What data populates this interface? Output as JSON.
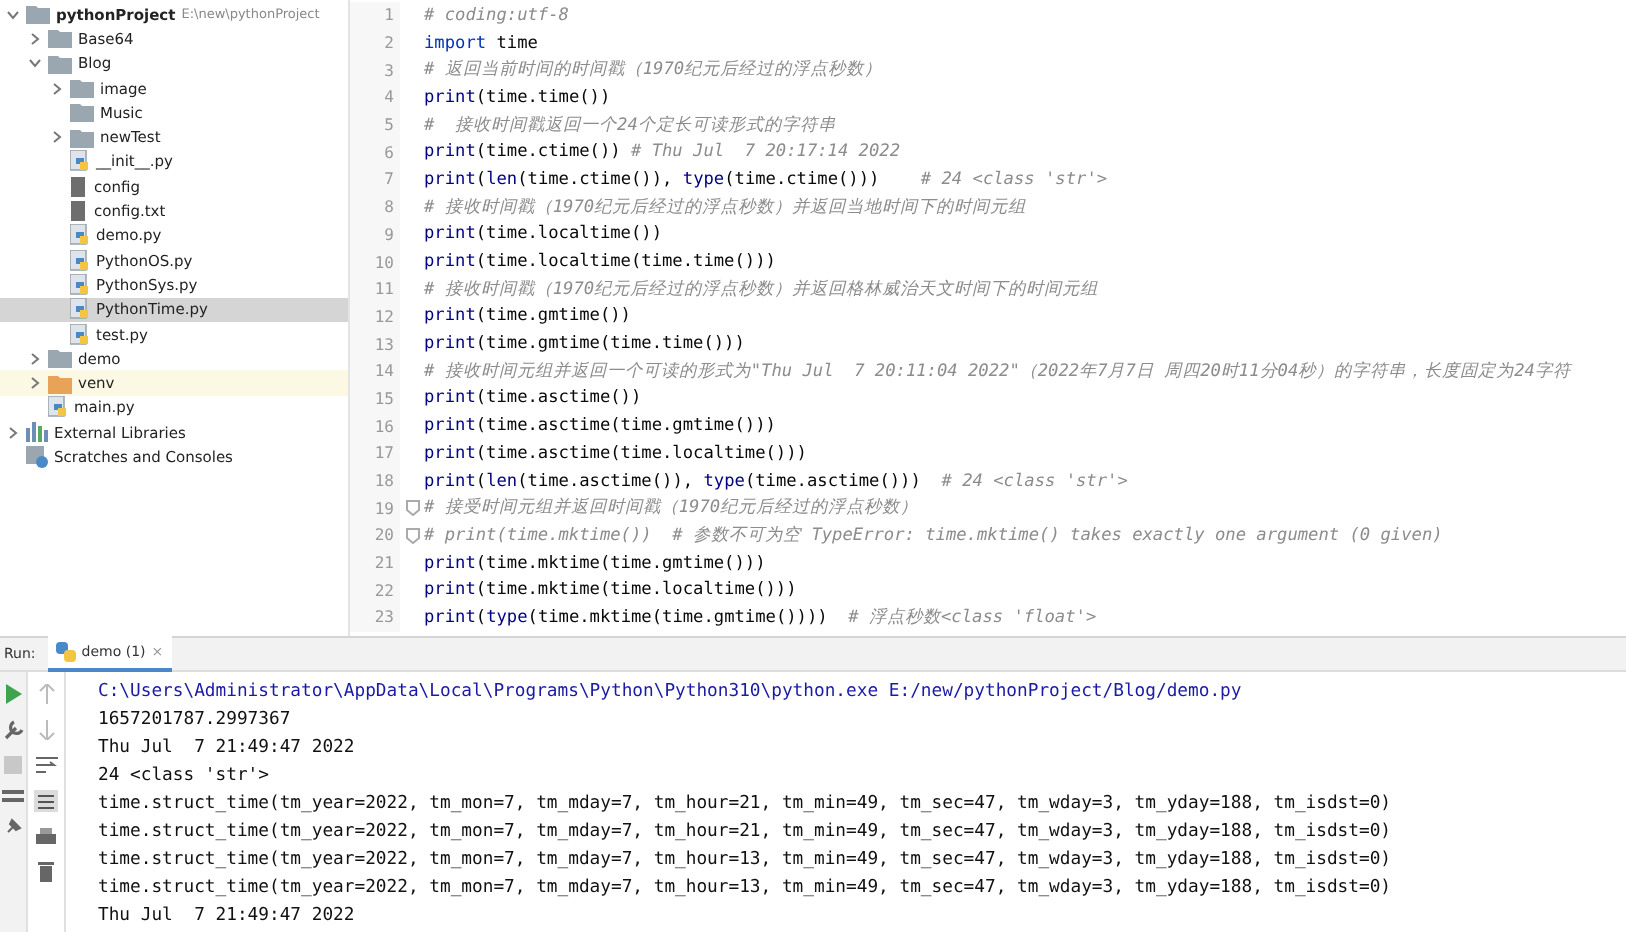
{
  "project_tree": {
    "items": [
      {
        "kind": "root",
        "label": "pythonProject",
        "path": "E:\\new\\pythonProject",
        "expanded": true,
        "selected": false,
        "children": [
          {
            "kind": "folder",
            "label": "Base64",
            "expanded": false,
            "selected": false
          },
          {
            "kind": "folder",
            "label": "Blog",
            "expanded": true,
            "selected": false,
            "children": [
              {
                "kind": "folder",
                "label": "image",
                "expanded": false,
                "selected": false
              },
              {
                "kind": "folder",
                "label": "Music",
                "selected": false
              },
              {
                "kind": "folder",
                "label": "newTest",
                "expanded": false,
                "selected": false
              },
              {
                "kind": "python",
                "label": "__init__.py",
                "selected": false
              },
              {
                "kind": "text",
                "label": "config",
                "selected": false
              },
              {
                "kind": "text",
                "label": "config.txt",
                "selected": false
              },
              {
                "kind": "python",
                "label": "demo.py",
                "selected": false
              },
              {
                "kind": "python",
                "label": "PythonOS.py",
                "selected": false
              },
              {
                "kind": "python",
                "label": "PythonSys.py",
                "selected": false
              },
              {
                "kind": "python",
                "label": "PythonTime.py",
                "selected": true
              },
              {
                "kind": "python",
                "label": "test.py",
                "selected": false
              }
            ]
          },
          {
            "kind": "folder",
            "label": "demo",
            "expanded": false,
            "selected": false
          },
          {
            "kind": "venv",
            "label": "venv",
            "expanded": false,
            "selected": false
          },
          {
            "kind": "python",
            "label": "main.py",
            "selected": false
          }
        ]
      },
      {
        "kind": "libraries",
        "label": "External Libraries",
        "expanded": false,
        "selected": false
      },
      {
        "kind": "scratches",
        "label": "Scratches and Consoles",
        "selected": false
      }
    ]
  },
  "editor": {
    "lines": [
      {
        "number": "1",
        "segments": [
          {
            "kind": "comment",
            "text": "# coding:utf-8"
          }
        ]
      },
      {
        "number": "2",
        "segments": [
          {
            "kind": "keyword",
            "text": "import"
          },
          {
            "kind": "code",
            "text": " time"
          }
        ]
      },
      {
        "number": "3",
        "segments": [
          {
            "kind": "comment",
            "text": "# 返回当前时间的时间戳（1970纪元后经过的浮点秒数）"
          }
        ]
      },
      {
        "number": "4",
        "segments": [
          {
            "kind": "builtin",
            "text": "print"
          },
          {
            "kind": "code",
            "text": "(time.time())"
          }
        ]
      },
      {
        "number": "5",
        "segments": [
          {
            "kind": "comment",
            "text": "#  接收时间戳返回一个24个定长可读形式的字符串"
          }
        ]
      },
      {
        "number": "6",
        "segments": [
          {
            "kind": "builtin",
            "text": "print"
          },
          {
            "kind": "code",
            "text": "(time.ctime()) "
          },
          {
            "kind": "comment",
            "text": "# Thu Jul  7 20:17:14 2022"
          }
        ]
      },
      {
        "number": "7",
        "segments": [
          {
            "kind": "builtin",
            "text": "print"
          },
          {
            "kind": "code",
            "text": "("
          },
          {
            "kind": "builtin",
            "text": "len"
          },
          {
            "kind": "code",
            "text": "(time.ctime()), "
          },
          {
            "kind": "builtin",
            "text": "type"
          },
          {
            "kind": "code",
            "text": "(time.ctime()))    "
          },
          {
            "kind": "comment",
            "text": "# 24 <class 'str'>"
          }
        ]
      },
      {
        "number": "8",
        "segments": [
          {
            "kind": "comment",
            "text": "# 接收时间戳（1970纪元后经过的浮点秒数）并返回当地时间下的时间元组"
          }
        ]
      },
      {
        "number": "9",
        "segments": [
          {
            "kind": "builtin",
            "text": "print"
          },
          {
            "kind": "code",
            "text": "(time.localtime())"
          }
        ]
      },
      {
        "number": "10",
        "segments": [
          {
            "kind": "builtin",
            "text": "print"
          },
          {
            "kind": "code",
            "text": "(time.localtime(time.time()))"
          }
        ]
      },
      {
        "number": "11",
        "segments": [
          {
            "kind": "comment",
            "text": "# 接收时间戳（1970纪元后经过的浮点秒数）并返回格林威治天文时间下的时间元组"
          }
        ]
      },
      {
        "number": "12",
        "segments": [
          {
            "kind": "builtin",
            "text": "print"
          },
          {
            "kind": "code",
            "text": "(time.gmtime())"
          }
        ]
      },
      {
        "number": "13",
        "segments": [
          {
            "kind": "builtin",
            "text": "print"
          },
          {
            "kind": "code",
            "text": "(time.gmtime(time.time()))"
          }
        ]
      },
      {
        "number": "14",
        "segments": [
          {
            "kind": "comment",
            "text": "# 接收时间元组并返回一个可读的形式为\"Thu Jul  7 20:11:04 2022\"（2022年7月7日 周四20时11分04秒）的字符串，长度固定为24字符"
          }
        ]
      },
      {
        "number": "15",
        "segments": [
          {
            "kind": "builtin",
            "text": "print"
          },
          {
            "kind": "code",
            "text": "(time.asctime())"
          }
        ]
      },
      {
        "number": "16",
        "segments": [
          {
            "kind": "builtin",
            "text": "print"
          },
          {
            "kind": "code",
            "text": "(time.asctime(time.gmtime()))"
          }
        ]
      },
      {
        "number": "17",
        "segments": [
          {
            "kind": "builtin",
            "text": "print"
          },
          {
            "kind": "code",
            "text": "(time.asctime(time.localtime()))"
          }
        ]
      },
      {
        "number": "18",
        "segments": [
          {
            "kind": "builtin",
            "text": "print"
          },
          {
            "kind": "code",
            "text": "("
          },
          {
            "kind": "builtin",
            "text": "len"
          },
          {
            "kind": "code",
            "text": "(time.asctime()), "
          },
          {
            "kind": "builtin",
            "text": "type"
          },
          {
            "kind": "code",
            "text": "(time.asctime()))  "
          },
          {
            "kind": "comment",
            "text": "# 24 <class 'str'>"
          }
        ]
      },
      {
        "number": "19",
        "fold": true,
        "segments": [
          {
            "kind": "comment",
            "text": "# 接受时间元组并返回时间戳（1970纪元后经过的浮点秒数）"
          }
        ]
      },
      {
        "number": "20",
        "fold": true,
        "segments": [
          {
            "kind": "comment",
            "text": "# print(time.mktime())  # 参数不可为空 TypeError: time.mktime() takes exactly one argument (0 given)"
          }
        ]
      },
      {
        "number": "21",
        "segments": [
          {
            "kind": "builtin",
            "text": "print"
          },
          {
            "kind": "code",
            "text": "(time.mktime(time.gmtime()))"
          }
        ]
      },
      {
        "number": "22",
        "segments": [
          {
            "kind": "builtin",
            "text": "print"
          },
          {
            "kind": "code",
            "text": "(time.mktime(time.localtime()))"
          }
        ]
      },
      {
        "number": "23",
        "segments": [
          {
            "kind": "builtin",
            "text": "print"
          },
          {
            "kind": "code",
            "text": "("
          },
          {
            "kind": "builtin",
            "text": "type"
          },
          {
            "kind": "code",
            "text": "(time.mktime(time.gmtime())))  "
          },
          {
            "kind": "comment",
            "text": "# 浮点秒数<class 'float'>"
          }
        ]
      }
    ]
  },
  "run_panel": {
    "label": "Run:",
    "tabs": [
      {
        "label": "demo (1)",
        "close": "×",
        "selected": true
      }
    ],
    "console": [
      {
        "kind": "command",
        "text": "C:\\Users\\Administrator\\AppData\\Local\\Programs\\Python\\Python310\\python.exe E:/new/pythonProject/Blog/demo.py"
      },
      {
        "kind": "output",
        "text": "1657201787.2997367"
      },
      {
        "kind": "output",
        "text": "Thu Jul  7 21:49:47 2022"
      },
      {
        "kind": "output",
        "text": "24 <class 'str'>"
      },
      {
        "kind": "output",
        "text": "time.struct_time(tm_year=2022, tm_mon=7, tm_mday=7, tm_hour=21, tm_min=49, tm_sec=47, tm_wday=3, tm_yday=188, tm_isdst=0)"
      },
      {
        "kind": "output",
        "text": "time.struct_time(tm_year=2022, tm_mon=7, tm_mday=7, tm_hour=21, tm_min=49, tm_sec=47, tm_wday=3, tm_yday=188, tm_isdst=0)"
      },
      {
        "kind": "output",
        "text": "time.struct_time(tm_year=2022, tm_mon=7, tm_mday=7, tm_hour=13, tm_min=49, tm_sec=47, tm_wday=3, tm_yday=188, tm_isdst=0)"
      },
      {
        "kind": "output",
        "text": "time.struct_time(tm_year=2022, tm_mon=7, tm_mday=7, tm_hour=13, tm_min=49, tm_sec=47, tm_wday=3, tm_yday=188, tm_isdst=0)"
      },
      {
        "kind": "output",
        "text": "Thu Jul  7 21:49:47 2022"
      }
    ]
  }
}
